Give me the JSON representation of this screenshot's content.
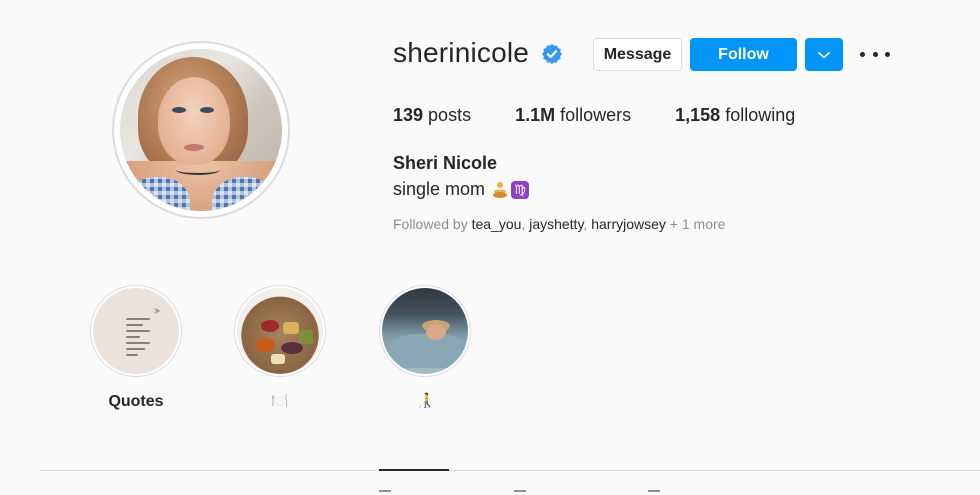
{
  "profile": {
    "username": "sherinicole",
    "verified": true,
    "full_name": "Sheri Nicole",
    "bio": "single mom",
    "bio_emojis": [
      "person-in-lotus-position-emoji",
      "virgo-emoji"
    ],
    "virgo_glyph": "♍"
  },
  "actions": {
    "message_label": "Message",
    "follow_label": "Follow",
    "dropdown_icon": "chevron-down-icon",
    "more_icon": "more-options-icon"
  },
  "stats": {
    "posts_count": "139",
    "posts_label": " posts",
    "followers_count": "1.1M",
    "followers_label": " followers",
    "following_count": "1,158",
    "following_label": " following"
  },
  "followed_by": {
    "prefix": "Followed by ",
    "accounts": [
      "tea_you",
      "jayshetty",
      "harryjowsey"
    ],
    "separator": ", ",
    "suffix": " + 1 more"
  },
  "highlights": [
    {
      "label": "Quotes",
      "cover": "quotes-card"
    },
    {
      "label": "🍽️",
      "cover": "food-board"
    },
    {
      "label": "🧑‍🦯",
      "cover": "sleeping-person"
    }
  ],
  "colors": {
    "accent": "#0095f6",
    "text_primary": "#262626",
    "text_secondary": "#8e8e8e",
    "border": "#dbdbdb",
    "background": "#fafafa",
    "verified_badge": "#3897f0"
  }
}
